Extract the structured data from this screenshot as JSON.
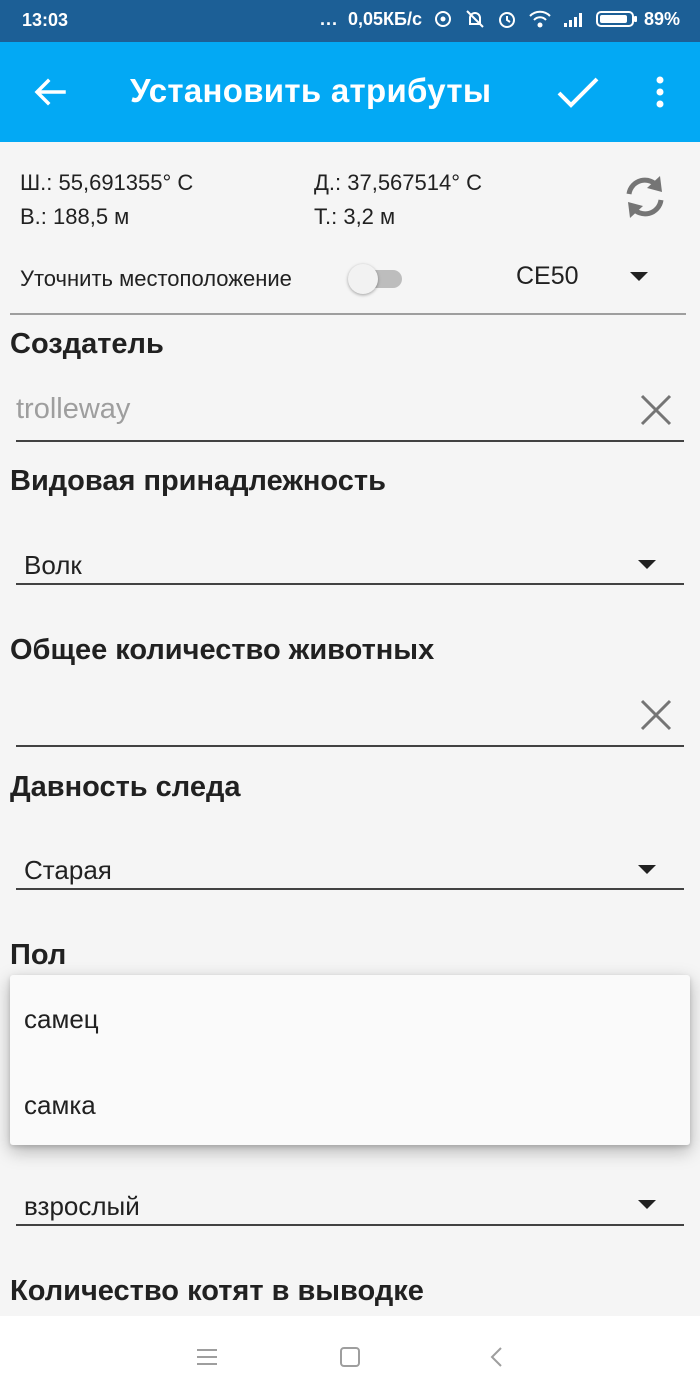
{
  "status_bar": {
    "time": "13:03",
    "dots": "...",
    "network_speed": "0,05КБ/с",
    "battery_percent": "89%",
    "battery_level": 0.89
  },
  "app_bar": {
    "title": "Установить атрибуты",
    "back_icon": "arrow-left-icon",
    "confirm_icon": "check-icon",
    "more_icon": "more-vert-icon"
  },
  "location": {
    "latitude": "Ш.: 55,691355° С",
    "longitude": "Д.: 37,567514° С",
    "altitude": "В.: 188,5 м",
    "accuracy": "Т.: 3,2 м",
    "refresh_icon": "refresh-icon",
    "refine_label": "Уточнить местоположение",
    "refine_enabled": false,
    "accuracy_mode": "CE50"
  },
  "fields": {
    "creator": {
      "label": "Создатель",
      "placeholder": "trolleway"
    },
    "species": {
      "label": "Видовая принадлежность",
      "value": "Волк"
    },
    "total_count": {
      "label": "Общее количество животных",
      "value": ""
    },
    "track_age": {
      "label": "Давность следа",
      "value": "Старая"
    },
    "sex": {
      "label": "Пол"
    },
    "age": {
      "value": "взрослый"
    },
    "kittens": {
      "label": "Количество котят в выводке"
    }
  },
  "sex_menu": {
    "options": [
      "самец",
      "самка"
    ]
  },
  "nav_bar": {
    "icons": [
      "menu-icon",
      "home-icon",
      "back-icon"
    ]
  },
  "colors": {
    "status_bar": "#1c5f96",
    "app_bar": "#03a9f4",
    "background": "#f5f5f5"
  }
}
